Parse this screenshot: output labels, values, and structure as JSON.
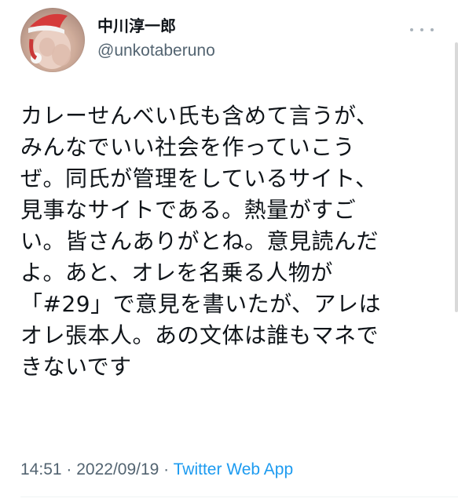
{
  "tweet": {
    "author": {
      "display_name": "中川淳一郎",
      "handle": "@unkotaberuno",
      "avatar_icon": "avatar-photo-santa-hat"
    },
    "more_icon": "more-dots-icon",
    "text_lines": [
      "カレーせんべい氏も含めて言うが、",
      "みんなでいい社会を作っていこう",
      "ぜ。同氏が管理をしているサイト、",
      "見事なサイトである。熱量がすご",
      "い。皆さんありがとね。意見読んだ",
      "よ。あと、オレを名乗る人物が",
      "「#29」で意見を書いたが、アレは",
      "オレ張本人。あの文体は誰もマネで",
      "きないです"
    ],
    "time": "14:51",
    "separator": " · ",
    "date": "2022/09/19",
    "source": "Twitter Web App"
  },
  "colors": {
    "text": "#0f1419",
    "secondary": "#536471",
    "link": "#1d9bf0"
  }
}
